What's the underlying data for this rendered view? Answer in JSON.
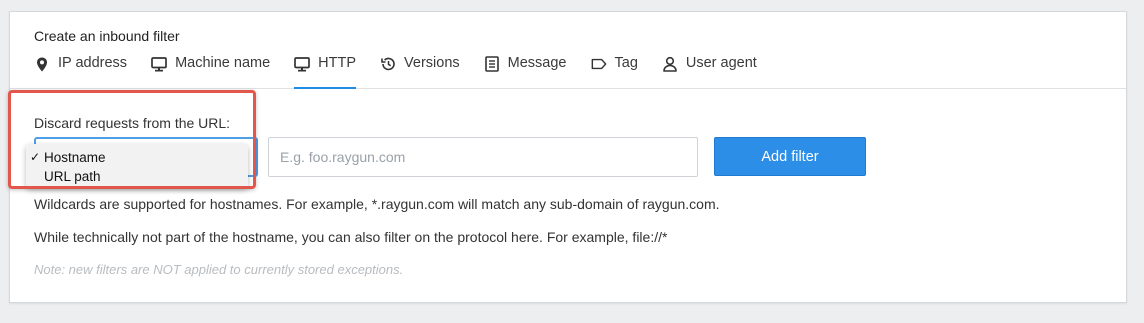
{
  "panel": {
    "title": "Create an inbound filter"
  },
  "tabs": [
    {
      "label": "IP address",
      "icon": "map-pin-icon",
      "active": false
    },
    {
      "label": "Machine name",
      "icon": "monitor-icon",
      "active": false
    },
    {
      "label": "HTTP",
      "icon": "monitor-icon",
      "active": true
    },
    {
      "label": "Versions",
      "icon": "history-icon",
      "active": false
    },
    {
      "label": "Message",
      "icon": "document-icon",
      "active": false
    },
    {
      "label": "Tag",
      "icon": "tag-icon",
      "active": false
    },
    {
      "label": "User agent",
      "icon": "user-icon",
      "active": false
    }
  ],
  "form": {
    "label": "Discard requests from the URL:",
    "type_options": [
      "Hostname",
      "URL path"
    ],
    "selected_option": "Hostname",
    "check_mark": "✓",
    "url_placeholder": "E.g. foo.raygun.com",
    "url_value": "",
    "add_button_label": "Add filter"
  },
  "help": {
    "wildcards": "Wildcards are supported for hostnames. For example, *.raygun.com will match any sub-domain of raygun.com.",
    "protocol": "While technically not part of the hostname, you can also filter on the protocol here. For example, file://*",
    "note": "Note: new filters are NOT applied to currently stored exceptions."
  },
  "colors": {
    "accent": "#2c8ee6",
    "active_tab_underline": "#1f8ce6",
    "highlight_border": "#e2574c"
  }
}
